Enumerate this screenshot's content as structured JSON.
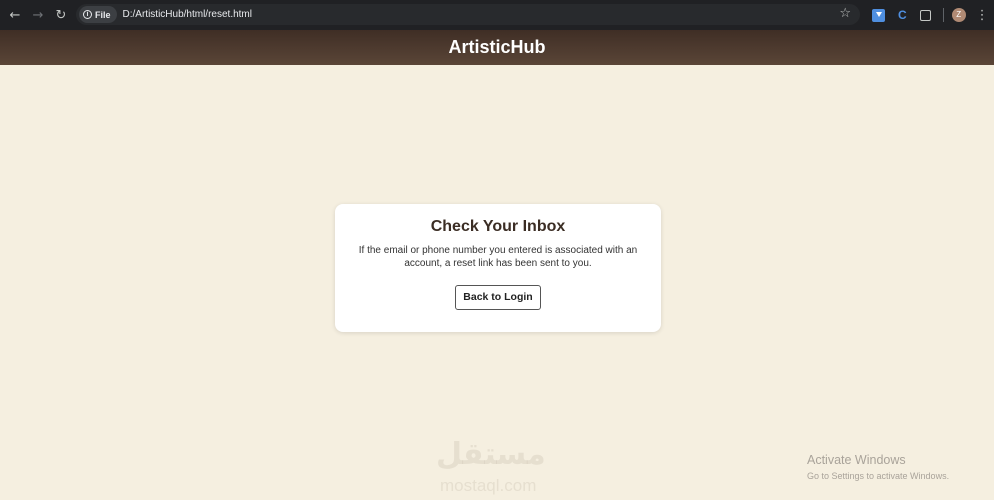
{
  "browser": {
    "chip_label": "File",
    "info_icon": "i",
    "url": "D:/ArtisticHub/html/reset.html",
    "avatar_letter": "Z"
  },
  "header": {
    "title": "ArtisticHub"
  },
  "card": {
    "title": "Check Your Inbox",
    "message": "If the email or phone number you entered is associated with an account, a reset link has been sent to you.",
    "button_label": "Back to Login"
  },
  "watermark": {
    "arabic": "مستقل",
    "latin": "mostaql.com"
  },
  "activation": {
    "title": "Activate Windows",
    "subtitle": "Go to Settings to activate Windows."
  }
}
